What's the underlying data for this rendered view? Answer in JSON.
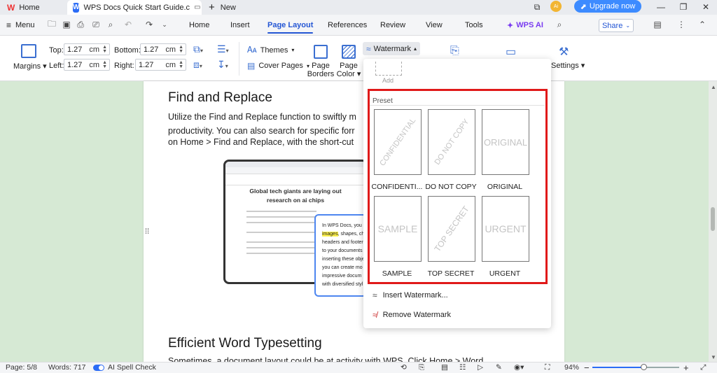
{
  "titlebar": {
    "home_tab": "Home",
    "doc_tab": "WPS Docs Quick Start Guide.c",
    "new_tab": "New",
    "upgrade": "Upgrade now",
    "avatar_initials": "Ai"
  },
  "menubar": {
    "menu_label": "Menu",
    "tabs": [
      "Home",
      "Insert",
      "Page Layout",
      "References",
      "Review",
      "View",
      "Tools"
    ],
    "active_tab": "Page Layout",
    "wps_ai": "WPS AI",
    "share": "Share"
  },
  "ribbon": {
    "margins_label": "Margins",
    "top_label": "Top:",
    "bottom_label": "Bottom:",
    "left_label": "Left:",
    "right_label": "Right:",
    "top_value": "1.27",
    "bottom_value": "1.27",
    "left_value": "1.27",
    "right_value": "1.27",
    "unit": "cm",
    "themes": "Themes",
    "cover_pages": "Cover Pages",
    "page_borders_1": "Page",
    "page_borders_2": "Borders",
    "page_color_1": "Page",
    "page_color_2": "Color",
    "watermark": "Watermark",
    "settings": "Settings"
  },
  "document": {
    "heading1": "Find and Replace",
    "para1_line1": "Utilize the Find and Replace function to swiftly m",
    "para1_line2": "productivity. You can also search for specific forr",
    "para1_line3": "on Home > Find and Replace, with the short-cut",
    "tablet_headline1": "Global tech giants are laying out",
    "tablet_headline2": "research on ai chips",
    "popup_lines": [
      "In WPS Docs, you c",
      "images, shapes, cha",
      "headers and footer",
      "to your documents",
      "inserting these obje",
      "you can create mo",
      "impressive docum",
      "with diversified styl"
    ],
    "popup_highlight": "images",
    "heading2": "Efficient Word Typesetting",
    "para2_line1": "Sometimes, a document layout could be at  activity with  WPS. Click Home > Word"
  },
  "watermark_menu": {
    "add_label": "Add",
    "preset_label": "Preset",
    "presets": [
      {
        "label": "CONFIDENTI...",
        "text": "CONFIDENTIAL"
      },
      {
        "label": "DO NOT COPY",
        "text": "DO NOT COPY"
      },
      {
        "label": "ORIGINAL",
        "text": "ORIGINAL"
      },
      {
        "label": "SAMPLE",
        "text": "SAMPLE"
      },
      {
        "label": "TOP SECRET",
        "text": "TOP SECRET"
      },
      {
        "label": "URGENT",
        "text": "URGENT"
      }
    ],
    "insert_label": "Insert Watermark...",
    "remove_label": "Remove Watermark"
  },
  "status": {
    "page": "Page: 5/8",
    "words": "Words: 717",
    "spell": "AI Spell Check",
    "zoom": "94%"
  },
  "colors": {
    "accent": "#2456d4",
    "highlight_box": "#e01919",
    "canvas": "#d6e9d4"
  }
}
